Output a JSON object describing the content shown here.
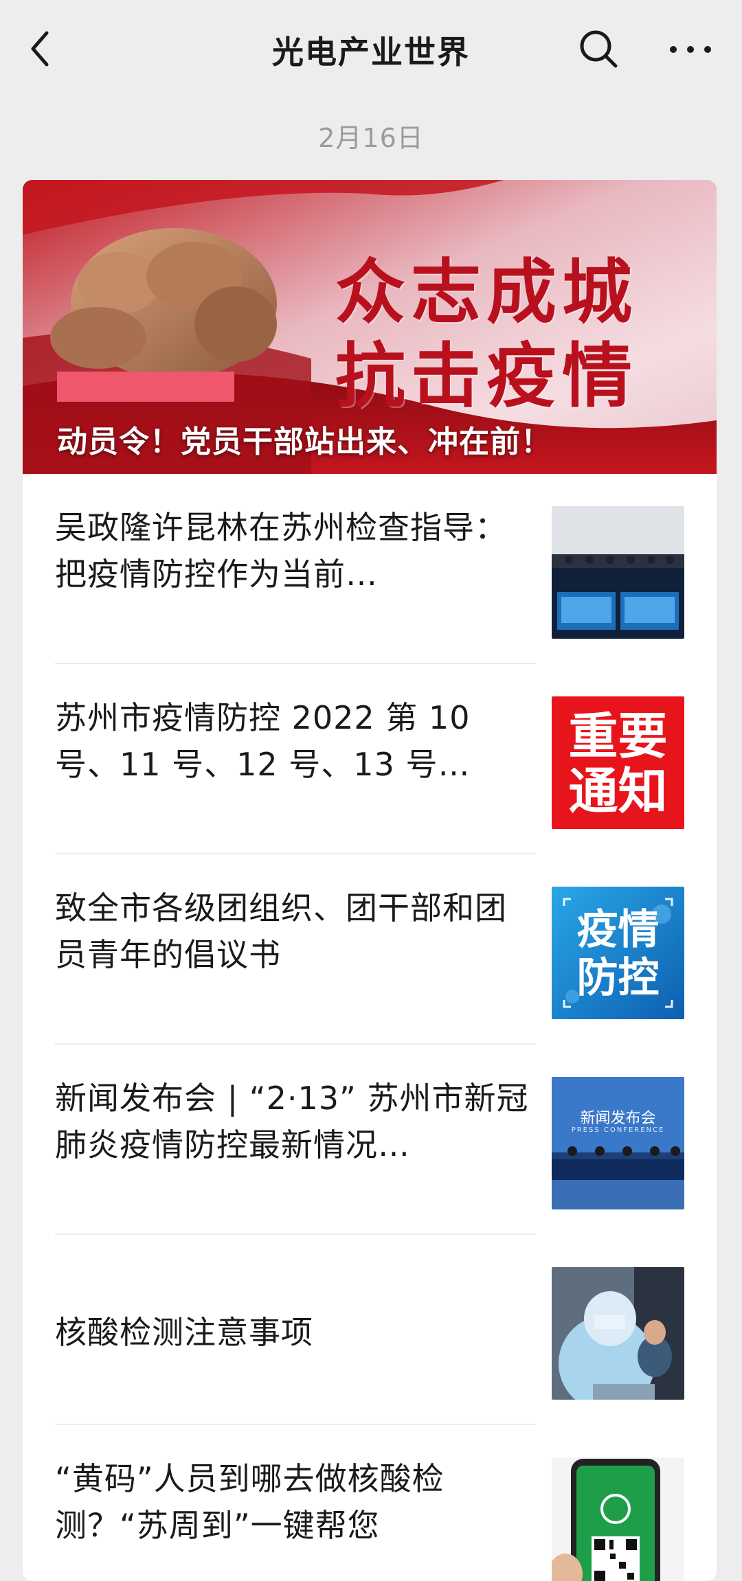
{
  "topbar": {
    "title": "光电产业世界",
    "back_icon": "chevron-left-icon",
    "search_icon": "search-icon",
    "more_icon": "more-dots-icon"
  },
  "date": "2月16日",
  "hero": {
    "slogan_line1": "众志成城",
    "slogan_line2": "抗击疫情",
    "caption": "动员令！党员干部站出来、冲在前！",
    "accent_color": "#b9101d"
  },
  "articles": [
    {
      "title": "吴政隆许昆林在苏州检查指导：把疫情防控作为当前…",
      "thumb": "meeting-photo"
    },
    {
      "title": "苏州市疫情防控 2022 第 10 号、11 号、12 号、13 号…",
      "thumb": "important-notice",
      "thumb_line1": "重要",
      "thumb_line2": "通知"
    },
    {
      "title": "致全市各级团组织、团干部和团员青年的倡议书",
      "thumb": "epidemic-prevention",
      "thumb_line1": "疫情",
      "thumb_line2": "防控"
    },
    {
      "title": "新闻发布会 | “2·13” 苏州市新冠肺炎疫情防控最新情况…",
      "thumb": "press-conference",
      "thumb_line1": "新闻发布会",
      "thumb_line2": "PRESS CONFERENCE"
    },
    {
      "title": "核酸检测注意事项",
      "thumb": "nucleic-acid-test-photo"
    },
    {
      "title": "“黄码”人员到哪去做核酸检测？“苏周到”一键帮您",
      "thumb": "phone-qr-code"
    }
  ]
}
